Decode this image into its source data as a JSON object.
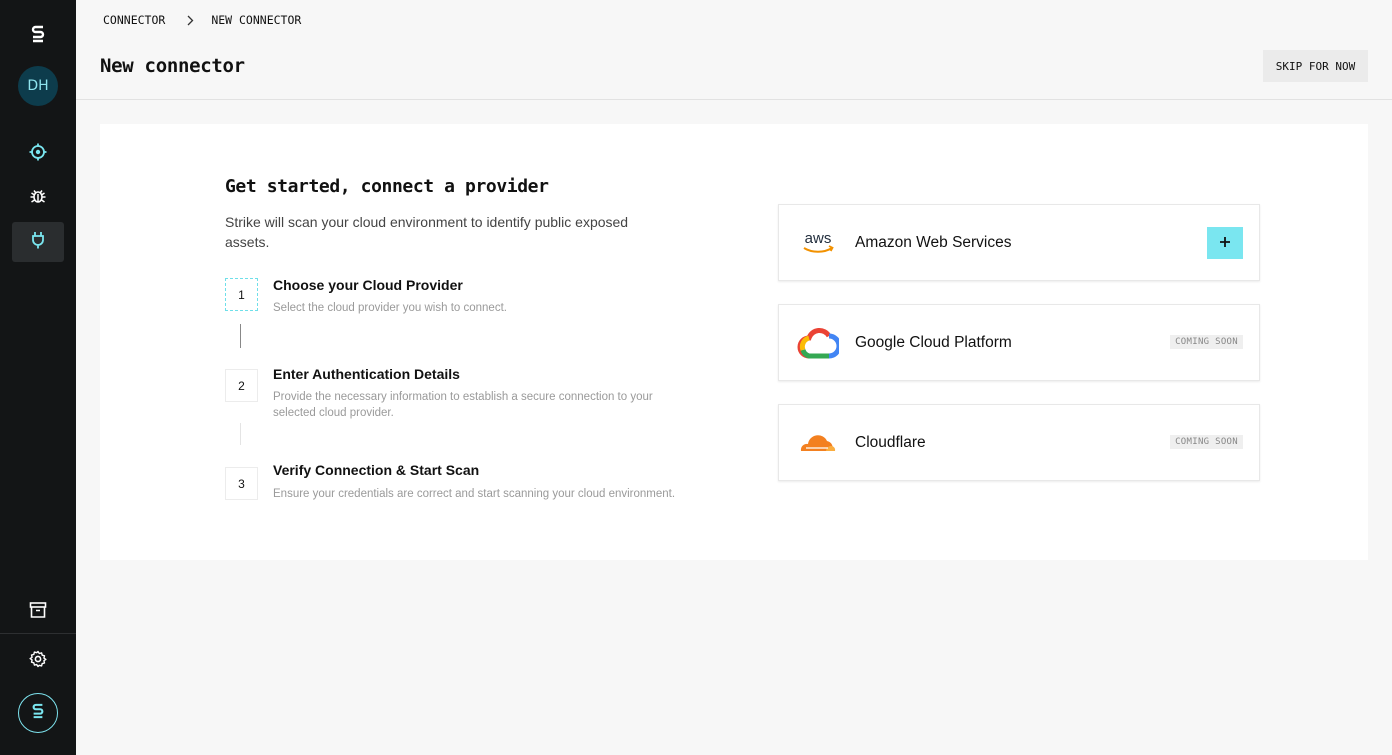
{
  "sidebar": {
    "avatar_initials": "DH",
    "items": [
      {
        "icon": "logo-icon"
      },
      {
        "icon": "target-icon"
      },
      {
        "icon": "bug-icon"
      },
      {
        "icon": "plug-icon",
        "active": true
      },
      {
        "icon": "archive-icon"
      },
      {
        "icon": "gear-icon"
      },
      {
        "icon": "logo-badge-icon"
      }
    ]
  },
  "breadcrumb": {
    "items": [
      "CONNECTOR",
      "NEW CONNECTOR"
    ]
  },
  "header": {
    "title": "New connector",
    "skip_label": "SKIP FOR NOW"
  },
  "intro": {
    "title": "Get started, connect a provider",
    "description": "Strike will scan your cloud environment to identify public exposed assets."
  },
  "steps": [
    {
      "number": "1",
      "title": "Choose your Cloud Provider",
      "description": "Select the cloud provider you wish to connect.",
      "active": true
    },
    {
      "number": "2",
      "title": "Enter Authentication Details",
      "description": "Provide the necessary information to establish a secure connection to your selected cloud provider."
    },
    {
      "number": "3",
      "title": "Verify Connection & Start Scan",
      "description": "Ensure your credentials are correct and start scanning your cloud environment."
    }
  ],
  "providers": [
    {
      "name": "Amazon Web Services",
      "logo": "aws-icon",
      "logo_text": "aws",
      "action": "add"
    },
    {
      "name": "Google Cloud Platform",
      "logo": "google-cloud-icon",
      "badge": "COMING SOON"
    },
    {
      "name": "Cloudflare",
      "logo": "cloudflare-icon",
      "badge": "COMING SOON"
    }
  ],
  "colors": {
    "sidebar_bg": "#131516",
    "accent": "#7ae6f0",
    "avatar_bg": "#0d3c4c"
  }
}
